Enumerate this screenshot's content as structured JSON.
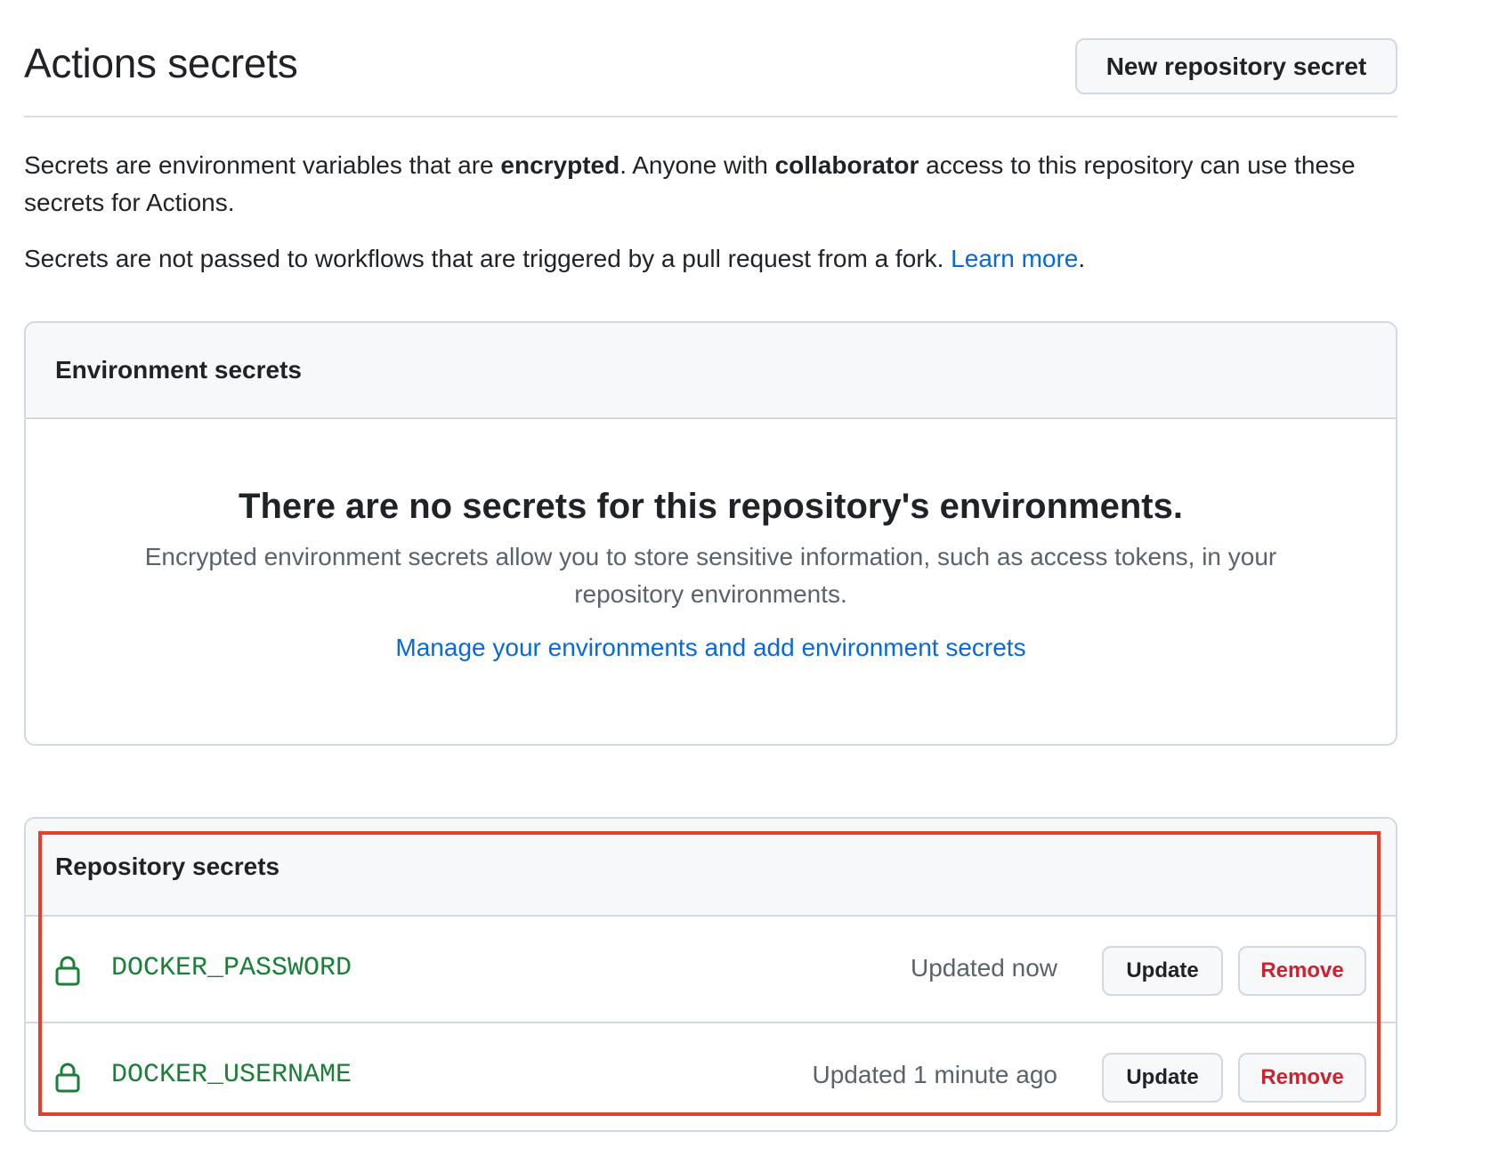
{
  "header": {
    "title": "Actions secrets",
    "new_secret_label": "New repository secret"
  },
  "description": {
    "p1_part1": "Secrets are environment variables that are ",
    "p1_bold1": "encrypted",
    "p1_part2": ". Anyone with ",
    "p1_bold2": "collaborator",
    "p1_part3": " access to this repository can use these secrets for Actions.",
    "p2_text": "Secrets are not passed to workflows that are triggered by a pull request from a fork. ",
    "p2_link": "Learn more",
    "p2_end": "."
  },
  "environment_secrets": {
    "heading": "Environment secrets",
    "empty_title": "There are no secrets for this repository's environments.",
    "empty_description": "Encrypted environment secrets allow you to store sensitive information, such as access tokens, in your repository environments.",
    "manage_link": "Manage your environments and add environment secrets"
  },
  "repository_secrets": {
    "heading": "Repository secrets",
    "items": [
      {
        "name": "DOCKER_PASSWORD",
        "updated": "Updated now",
        "update_label": "Update",
        "remove_label": "Remove",
        "icon": "lock-icon"
      },
      {
        "name": "DOCKER_USERNAME",
        "updated": "Updated 1 minute ago",
        "update_label": "Update",
        "remove_label": "Remove",
        "icon": "lock-icon"
      }
    ]
  },
  "colors": {
    "accent_link": "#0969da",
    "secret_name": "#1a7f37",
    "danger": "#cf222e",
    "highlight": "#e3402c"
  }
}
